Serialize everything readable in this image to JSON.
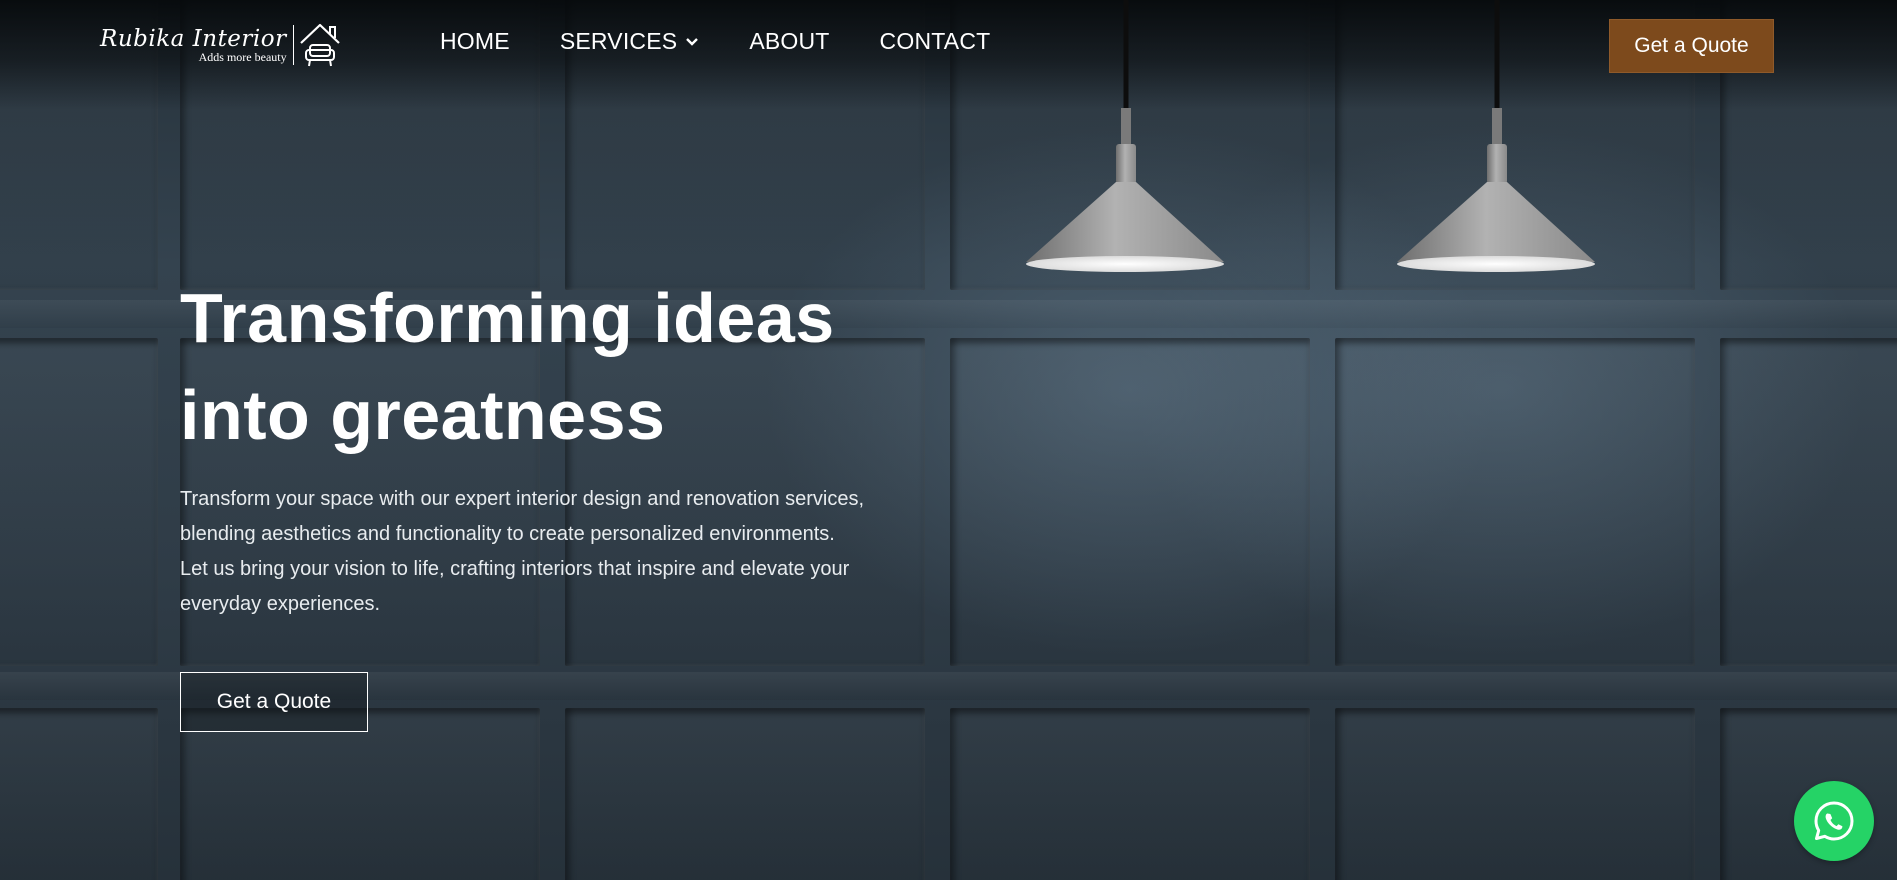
{
  "brand": {
    "name": "Rubika Interior",
    "tagline": "Adds more beauty",
    "icon": "sofa-house-icon"
  },
  "nav": {
    "items": [
      {
        "label": "HOME"
      },
      {
        "label": "SERVICES",
        "icon": "chevron-down-icon"
      },
      {
        "label": "ABOUT"
      },
      {
        "label": "CONTACT"
      }
    ]
  },
  "header_cta": {
    "label": "Get a Quote"
  },
  "hero": {
    "title_line1": "Transforming ideas",
    "title_line2": "into greatness",
    "description_lines": [
      "Transform your space with our expert interior design and renovation services,",
      "blending aesthetics and functionality to create personalized environments.",
      "Let us bring your vision to life, crafting interiors that inspire and elevate your",
      "everyday experiences."
    ],
    "cta": {
      "label": "Get a Quote"
    }
  },
  "whatsapp": {
    "icon": "whatsapp-icon"
  },
  "colors": {
    "accent": "#7d4a1c",
    "whatsapp_green": "#25d366",
    "text": "#ffffff",
    "wall": "#34434f"
  }
}
